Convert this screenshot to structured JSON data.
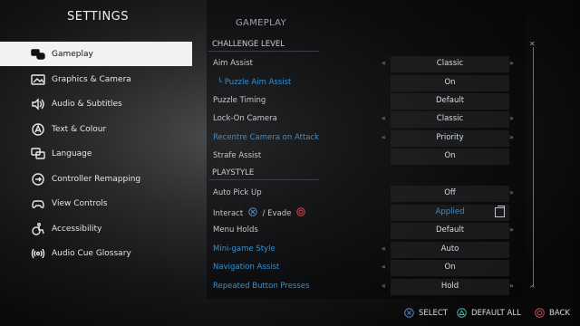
{
  "title": "SETTINGS",
  "menu": [
    {
      "label": "Gameplay",
      "icon": "gameplay-icon",
      "active": true
    },
    {
      "label": "Graphics & Camera",
      "icon": "graphics-camera-icon"
    },
    {
      "label": "Audio & Subtitles",
      "icon": "audio-subtitles-icon"
    },
    {
      "label": "Text & Colour",
      "icon": "text-colour-icon"
    },
    {
      "label": "Language",
      "icon": "language-icon"
    },
    {
      "label": "Controller Remapping",
      "icon": "controller-remapping-icon"
    },
    {
      "label": "View Controls",
      "icon": "view-controls-icon"
    },
    {
      "label": "Accessibility",
      "icon": "accessibility-icon"
    },
    {
      "label": "Audio Cue Glossary",
      "icon": "audio-cue-glossary-icon"
    }
  ],
  "panel": {
    "title": "GAMEPLAY",
    "sections": {
      "challenge": "CHALLENGE LEVEL",
      "playstyle": "PLAYSTYLE"
    },
    "rows": [
      {
        "label": "Aim Assist",
        "value": "Classic"
      },
      {
        "label": "Puzzle Aim Assist",
        "value": "On"
      },
      {
        "label": "Puzzle Timing",
        "value": "Default"
      },
      {
        "label": "Lock-On Camera",
        "value": "Classic"
      },
      {
        "label": "Recentre Camera on Attack",
        "value": "Priority"
      },
      {
        "label": "Strafe Assist",
        "value": "On"
      },
      {
        "label": "Auto Pick Up",
        "value": "Off"
      },
      {
        "label_prefix": "Interact",
        "label_suffix": "/ Evade",
        "value": "Applied"
      },
      {
        "label": "Menu Holds",
        "value": "Default"
      },
      {
        "label": "Mini-game Style",
        "value": "Auto"
      },
      {
        "label": "Navigation Assist",
        "value": "On"
      },
      {
        "label": "Repeated Button Presses",
        "value": "Hold"
      }
    ]
  },
  "footer": {
    "select": "SELECT",
    "default_all": "DEFAULT ALL",
    "back": "BACK"
  },
  "colors": {
    "accent_blue": "#3a8fd0",
    "cross": "#5d86c8",
    "triangle": "#3fb9a6",
    "circle": "#e0404a",
    "active_bg": "#f2f2f2"
  }
}
